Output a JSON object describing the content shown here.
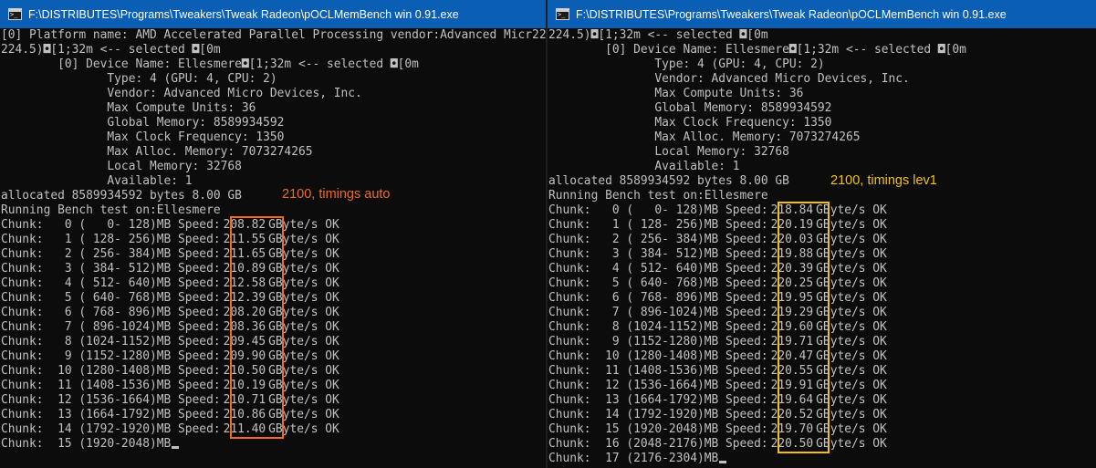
{
  "windows": [
    {
      "title": "F:\\DISTRIBUTES\\Programs\\Tweakers\\Tweak Radeon\\pOCLMemBench win 0.91.exe",
      "header_lines": [
        "[0] Platform name: AMD Accelerated Parallel Processing vendor:Advanced Micr224.5)◘[1;32m <-- selected ◘[0m",
        "224.5)◘[1;32m <-- selected ◘[0m",
        "        [0] Device Name: Ellesmere◘[1;32m <-- selected ◘[0m",
        "               Type: 4 (GPU: 4, CPU: 2)",
        "               Vendor: Advanced Micro Devices, Inc.",
        "               Max Compute Units: 36",
        "               Global Memory: 8589934592",
        "               Max Clock Frequency: 1350",
        "               Max Alloc. Memory: 7073274265",
        "               Local Memory: 32768",
        "               Available: 1",
        "allocated 8589934592 bytes 8.00 GB",
        "Running Bench test on:Ellesmere"
      ],
      "annotation": "2100, timings auto",
      "chunks": [
        {
          "prefix": "Chunk:   0 (   0- 128)MB Speed:",
          "speed": "208.82",
          "suffix": "GByte/s OK"
        },
        {
          "prefix": "Chunk:   1 ( 128- 256)MB Speed:",
          "speed": "211.55",
          "suffix": "GByte/s OK"
        },
        {
          "prefix": "Chunk:   2 ( 256- 384)MB Speed:",
          "speed": "211.65",
          "suffix": "GByte/s OK"
        },
        {
          "prefix": "Chunk:   3 ( 384- 512)MB Speed:",
          "speed": "210.89",
          "suffix": "GByte/s OK"
        },
        {
          "prefix": "Chunk:   4 ( 512- 640)MB Speed:",
          "speed": "212.58",
          "suffix": "GByte/s OK"
        },
        {
          "prefix": "Chunk:   5 ( 640- 768)MB Speed:",
          "speed": "212.39",
          "suffix": "GByte/s OK"
        },
        {
          "prefix": "Chunk:   6 ( 768- 896)MB Speed:",
          "speed": "208.20",
          "suffix": "GByte/s OK"
        },
        {
          "prefix": "Chunk:   7 ( 896-1024)MB Speed:",
          "speed": "208.36",
          "suffix": "GByte/s OK"
        },
        {
          "prefix": "Chunk:   8 (1024-1152)MB Speed:",
          "speed": "209.45",
          "suffix": "GByte/s OK"
        },
        {
          "prefix": "Chunk:   9 (1152-1280)MB Speed:",
          "speed": "209.90",
          "suffix": "GByte/s OK"
        },
        {
          "prefix": "Chunk:  10 (1280-1408)MB Speed:",
          "speed": "210.50",
          "suffix": "GByte/s OK"
        },
        {
          "prefix": "Chunk:  11 (1408-1536)MB Speed:",
          "speed": "210.19",
          "suffix": "GByte/s OK"
        },
        {
          "prefix": "Chunk:  12 (1536-1664)MB Speed:",
          "speed": "210.71",
          "suffix": "GByte/s OK"
        },
        {
          "prefix": "Chunk:  13 (1664-1792)MB Speed:",
          "speed": "210.86",
          "suffix": "GByte/s OK"
        },
        {
          "prefix": "Chunk:  14 (1792-1920)MB Speed:",
          "speed": "211.40",
          "suffix": "GByte/s OK"
        }
      ],
      "last_line": "Chunk:  15 (1920-2048)MB"
    },
    {
      "title": "F:\\DISTRIBUTES\\Programs\\Tweakers\\Tweak Radeon\\pOCLMemBench win 0.91.exe",
      "header_lines": [
        "224.5)◘[1;32m <-- selected ◘[0m",
        "        [0] Device Name: Ellesmere◘[1;32m <-- selected ◘[0m",
        "               Type: 4 (GPU: 4, CPU: 2)",
        "               Vendor: Advanced Micro Devices, Inc.",
        "               Max Compute Units: 36",
        "               Global Memory: 8589934592",
        "               Max Clock Frequency: 1350",
        "               Max Alloc. Memory: 7073274265",
        "               Local Memory: 32768",
        "               Available: 1",
        "allocated 8589934592 bytes 8.00 GB",
        "Running Bench test on:Ellesmere"
      ],
      "annotation": "2100, timings lev1",
      "chunks": [
        {
          "prefix": "Chunk:   0 (   0- 128)MB Speed:",
          "speed": "218.84",
          "suffix": "GByte/s OK"
        },
        {
          "prefix": "Chunk:   1 ( 128- 256)MB Speed:",
          "speed": "220.19",
          "suffix": "GByte/s OK"
        },
        {
          "prefix": "Chunk:   2 ( 256- 384)MB Speed:",
          "speed": "220.03",
          "suffix": "GByte/s OK"
        },
        {
          "prefix": "Chunk:   3 ( 384- 512)MB Speed:",
          "speed": "219.88",
          "suffix": "GByte/s OK"
        },
        {
          "prefix": "Chunk:   4 ( 512- 640)MB Speed:",
          "speed": "220.39",
          "suffix": "GByte/s OK"
        },
        {
          "prefix": "Chunk:   5 ( 640- 768)MB Speed:",
          "speed": "220.25",
          "suffix": "GByte/s OK"
        },
        {
          "prefix": "Chunk:   6 ( 768- 896)MB Speed:",
          "speed": "219.95",
          "suffix": "GByte/s OK"
        },
        {
          "prefix": "Chunk:   7 ( 896-1024)MB Speed:",
          "speed": "219.29",
          "suffix": "GByte/s OK"
        },
        {
          "prefix": "Chunk:   8 (1024-1152)MB Speed:",
          "speed": "219.60",
          "suffix": "GByte/s OK"
        },
        {
          "prefix": "Chunk:   9 (1152-1280)MB Speed:",
          "speed": "219.71",
          "suffix": "GByte/s OK"
        },
        {
          "prefix": "Chunk:  10 (1280-1408)MB Speed:",
          "speed": "220.47",
          "suffix": "GByte/s OK"
        },
        {
          "prefix": "Chunk:  11 (1408-1536)MB Speed:",
          "speed": "220.55",
          "suffix": "GByte/s OK"
        },
        {
          "prefix": "Chunk:  12 (1536-1664)MB Speed:",
          "speed": "219.91",
          "suffix": "GByte/s OK"
        },
        {
          "prefix": "Chunk:  13 (1664-1792)MB Speed:",
          "speed": "219.64",
          "suffix": "GByte/s OK"
        },
        {
          "prefix": "Chunk:  14 (1792-1920)MB Speed:",
          "speed": "220.52",
          "suffix": "GByte/s OK"
        },
        {
          "prefix": "Chunk:  15 (1920-2048)MB Speed:",
          "speed": "219.70",
          "suffix": "GByte/s OK"
        },
        {
          "prefix": "Chunk:  16 (2048-2176)MB Speed:",
          "speed": "220.50",
          "suffix": "GByte/s OK"
        }
      ],
      "last_line": "Chunk:  17 (2176-2304)MB"
    }
  ],
  "colors": {
    "titlebar": "#0a5fb4",
    "console_bg": "#0c0c0c",
    "console_text": "#c0c0c0",
    "highlight_left": "#f26a22",
    "highlight_right": "#f2c014"
  }
}
